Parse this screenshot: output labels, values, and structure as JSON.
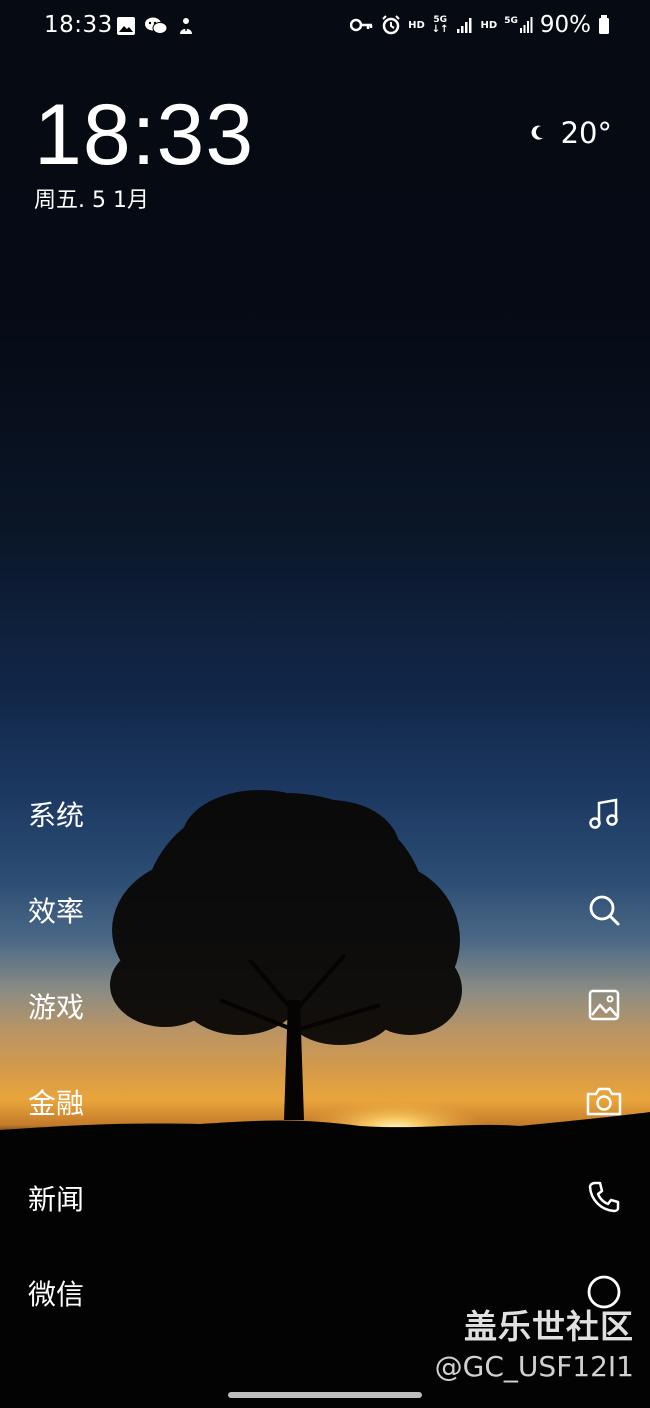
{
  "status_bar": {
    "time": "18:33",
    "hd1": "HD",
    "net1": "5G",
    "hd2": "HD",
    "net2": "5G",
    "battery": "90%",
    "icons": [
      "gallery-icon",
      "wechat-icon",
      "app-notification-icon",
      "key-icon",
      "alarm-icon",
      "data-arrows-icon",
      "signal-icon",
      "battery-icon"
    ]
  },
  "lock": {
    "clock": "18:33",
    "date": "周五. 5 1月",
    "weather_icon": "moon-icon",
    "temperature": "20°"
  },
  "categories": [
    "系统",
    "效率",
    "游戏",
    "金融",
    "新闻",
    "微信"
  ],
  "shortcuts": [
    "music-note-icon",
    "search-icon",
    "image-icon",
    "camera-icon",
    "phone-icon",
    "circle-icon"
  ],
  "watermark": {
    "title": "盖乐世社区",
    "user": "@GC_USF12I1"
  },
  "colors": {
    "sky_top": "#060a12",
    "sky_mid": "#1d3a63",
    "sunset": "#e9a53c",
    "foreground": "#050403"
  }
}
